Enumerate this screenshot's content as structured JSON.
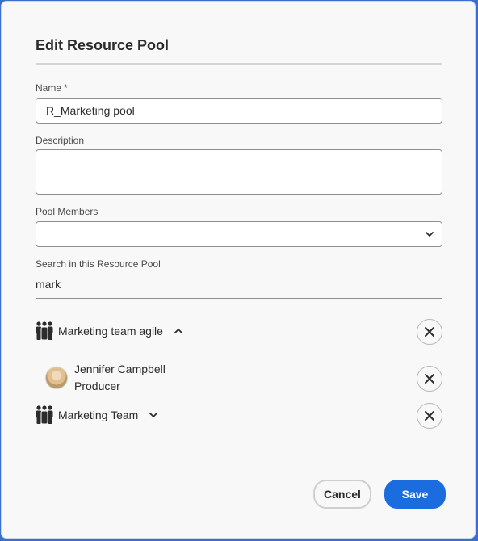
{
  "dialog": {
    "title": "Edit Resource Pool"
  },
  "name_field": {
    "label": "Name",
    "required_mark": "*",
    "value": "R_Marketing pool"
  },
  "description_field": {
    "label": "Description",
    "value": ""
  },
  "pool_members": {
    "label": "Pool Members",
    "value": ""
  },
  "search": {
    "label": "Search in this Resource Pool",
    "value": "mark"
  },
  "results": {
    "team1": {
      "name": "Marketing team agile",
      "expanded": true,
      "icon": "team-icon"
    },
    "person1": {
      "name": "Jennifer Campbell",
      "role": "Producer",
      "icon": "avatar"
    },
    "team2": {
      "name": "Marketing Team",
      "expanded": false,
      "icon": "team-icon"
    }
  },
  "footer": {
    "cancel_label": "Cancel",
    "save_label": "Save"
  },
  "colors": {
    "accent": "#1b6ddf",
    "frame": "#3a6fd0"
  }
}
